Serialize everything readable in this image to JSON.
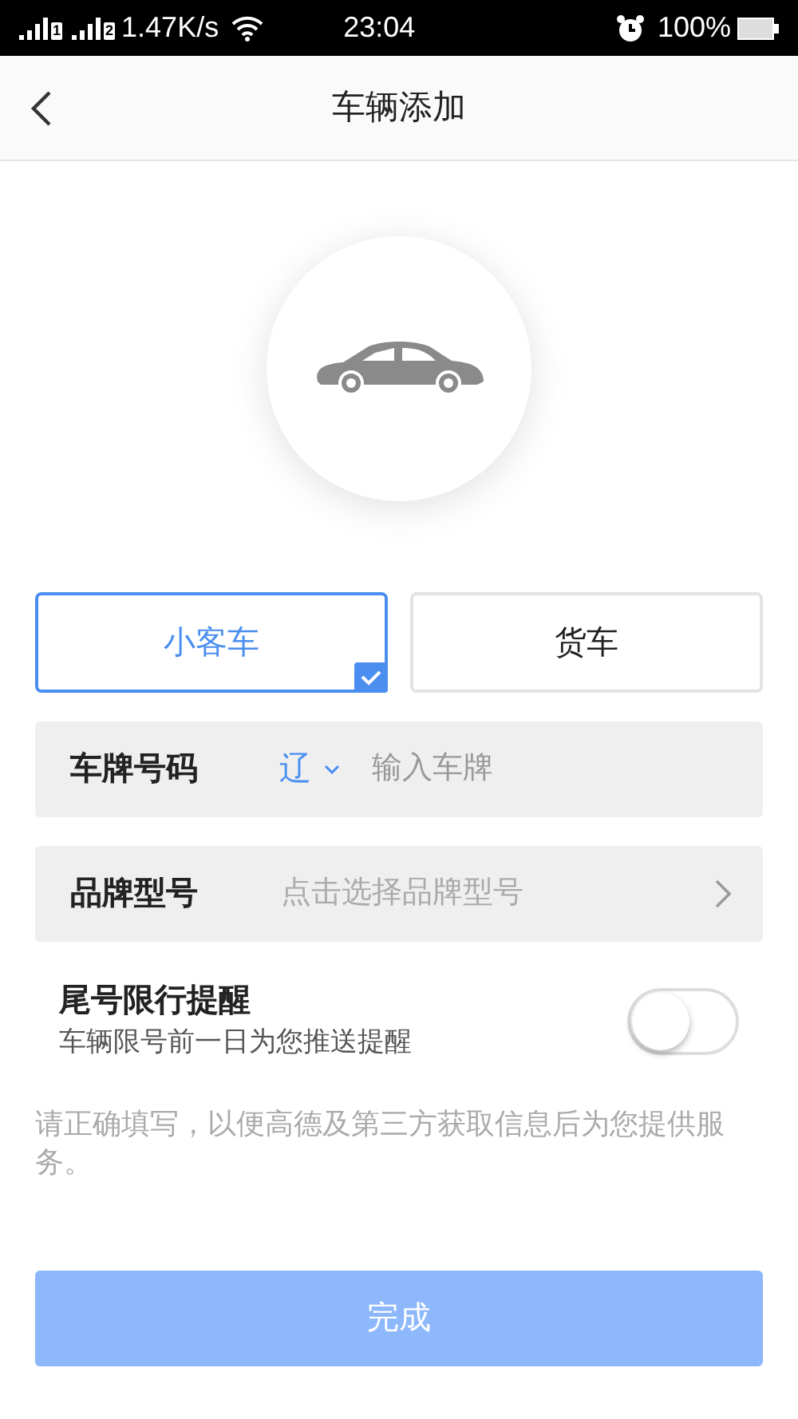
{
  "status_bar": {
    "sim_1": "1",
    "sim_2": "2",
    "speed": "1.47K/s",
    "time": "23:04",
    "battery": "100%"
  },
  "header": {
    "title": "车辆添加"
  },
  "vehicle_types": [
    {
      "label": "小客车",
      "selected": true
    },
    {
      "label": "货车",
      "selected": false
    }
  ],
  "plate": {
    "label": "车牌号码",
    "province": "辽",
    "placeholder": "输入车牌"
  },
  "brand": {
    "label": "品牌型号",
    "placeholder": "点击选择品牌型号"
  },
  "reminder": {
    "title": "尾号限行提醒",
    "subtitle": "车辆限号前一日为您推送提醒",
    "on": false
  },
  "note": "请正确填写，以便高德及第三方获取信息后为您提供服务。",
  "submit": {
    "label": "完成",
    "disabled": true
  }
}
